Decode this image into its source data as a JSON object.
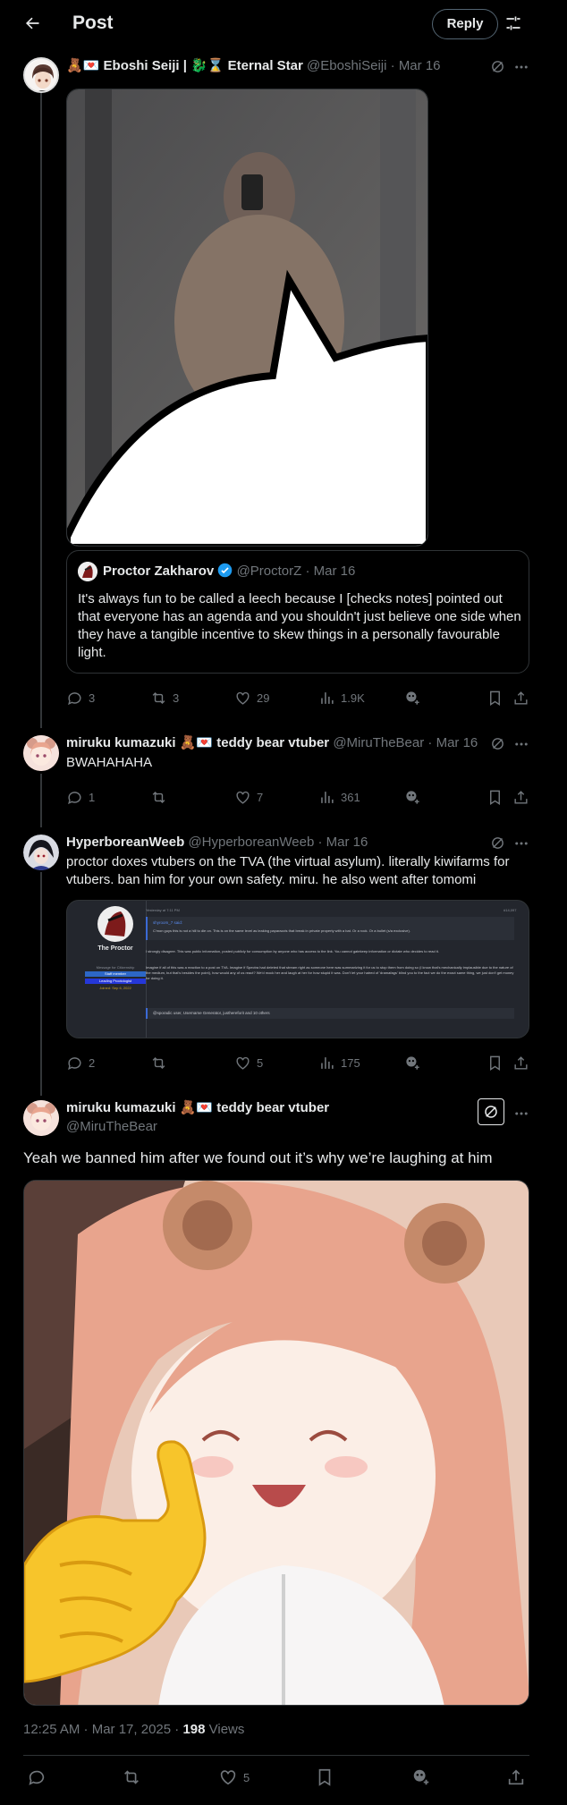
{
  "header": {
    "title": "Post",
    "reply_label": "Reply"
  },
  "post1": {
    "name": "Eboshi Seiji |",
    "name_suffix": "Eternal Star",
    "handle": "@EboshiSeiji",
    "date": "Mar 16",
    "quote": {
      "name": "Proctor Zakharov",
      "handle": "@ProctorZ",
      "date": "Mar 16",
      "text": "It's always fun to be called a leech because I [checks notes] pointed out that everyone has an agenda and you shouldn't just believe one side when they have a tangible incentive to skew things in a personally favourable light."
    },
    "stats": {
      "replies": "3",
      "reposts": "3",
      "likes": "29",
      "views": "1.9K"
    }
  },
  "post2": {
    "name": "miruku kumazuki",
    "name_suffix": "teddy bear vtuber",
    "handle": "@MiruTheBear",
    "date": "Mar 16",
    "text": "BWAHAHAHA",
    "stats": {
      "replies": "1",
      "reposts": "",
      "likes": "7",
      "views": "361"
    }
  },
  "post3": {
    "name": "HyperboreanWeeb",
    "handle": "@HyperboreanWeeb",
    "date": "Mar 16",
    "text": "proctor doxes vtubers on the TVA (the virtual asylum). literally kiwifarms for vtubers. ban him for your own safety. miru. he also went after tomomi",
    "screenshot": {
      "user_label": "The Proctor",
      "role1": "Message for Citizenship",
      "role2": "Staff member",
      "role3": "Leading Proctologist",
      "joined": "Joined: Sep 6, 2022",
      "date_text": "Yesterday at 7:11 PM",
      "post_num": "#14,097",
      "quote_user": "shyroom_7 said:",
      "quote_line": "C'mon guys this is not a hill to die on. This is on the same level as leaking paparazzis that break in private property with a bat. Or a rock. Or a bullet (s/a exclusive).",
      "para1": "I strongly disagree. This was public information, posted publicly for consumption by anyone who has access to the link. You cannot gatekeep information or dictate who decides to read it.",
      "para2": "Imagine if all of this was a reaction to a post on TVA. Imagine if Spectra had deleted that stream right as someone here was summarizing it for us to stop them from doing so (I know that's mechanically implausible due to the nature of the medium, but that's besides the point), how would any of us react? We'd mock her and laugh at her for how stupid it was. Don't let your hatred of 'dramafags' blind you to the fact we do the exact same thing, we just don't get money for doing it.",
      "reactions": "@sporadic user, Username Generator, justhereforit and 10 others"
    },
    "stats": {
      "replies": "2",
      "reposts": "",
      "likes": "5",
      "views": "175"
    }
  },
  "main": {
    "name": "miruku kumazuki",
    "name_suffix": "teddy bear vtuber",
    "handle": "@MiruTheBear",
    "text": "Yeah we banned him after we found out it’s why we’re laughing at him",
    "time": "12:25 AM · Mar 17, 2025 ·",
    "views_count": "198",
    "views_label": "Views",
    "stats": {
      "replies": "",
      "reposts": "",
      "likes": "5"
    }
  },
  "colors": {
    "bg": "#000000",
    "text": "#e7e9ea",
    "muted": "#71767b",
    "border": "#2f3336",
    "verified": "#1d9bf0"
  },
  "emoji": {
    "eboshi_prefix": "teddy-bear, heart-letter",
    "eboshi_suffix_prefix": "dragon, hourglass",
    "miru_prefix": "teddy-bear, heart-letter"
  }
}
